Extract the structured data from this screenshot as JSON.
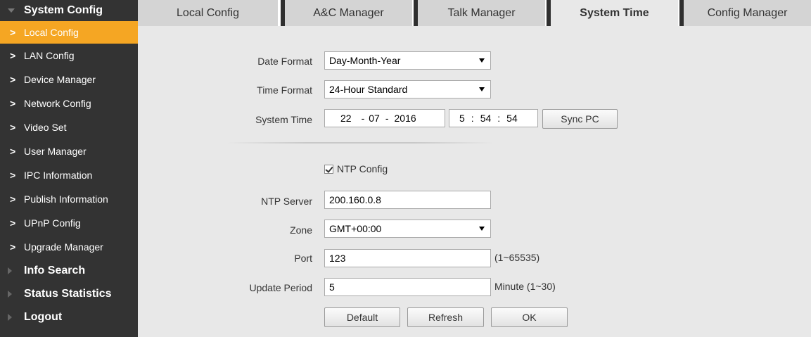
{
  "sidebar": {
    "system_config": "System Config",
    "items": [
      {
        "label": "Local Config"
      },
      {
        "label": "LAN Config"
      },
      {
        "label": "Device Manager"
      },
      {
        "label": "Network Config"
      },
      {
        "label": "Video Set"
      },
      {
        "label": "User Manager"
      },
      {
        "label": "IPC Information"
      },
      {
        "label": "Publish Information"
      },
      {
        "label": "UPnP Config"
      },
      {
        "label": "Upgrade Manager"
      }
    ],
    "chevron": ">",
    "info_search": "Info Search",
    "status_statistics": "Status Statistics",
    "logout": "Logout"
  },
  "tabs": [
    {
      "label": "Local Config"
    },
    {
      "label": "A&C Manager"
    },
    {
      "label": "Talk Manager"
    },
    {
      "label": "System Time"
    },
    {
      "label": "Config Manager"
    }
  ],
  "form": {
    "date_format_label": "Date Format",
    "date_format_value": "Day-Month-Year",
    "time_format_label": "Time Format",
    "time_format_value": "24-Hour Standard",
    "system_time_label": "System Time",
    "day": "22",
    "month": "07",
    "year": "2016",
    "date_sep": "-",
    "hour": "5",
    "minute": "54",
    "second": "54",
    "time_sep": ":",
    "sync_pc": "Sync PC",
    "ntp_config": "NTP Config",
    "ntp_server_label": "NTP Server",
    "ntp_server_value": "200.160.0.8",
    "zone_label": "Zone",
    "zone_value": "GMT+00:00",
    "port_label": "Port",
    "port_value": "123",
    "port_hint": "(1~65535)",
    "update_period_label": "Update Period",
    "update_period_value": "5",
    "update_period_hint": "Minute (1~30)"
  },
  "buttons": {
    "default": "Default",
    "refresh": "Refresh",
    "ok": "OK"
  }
}
